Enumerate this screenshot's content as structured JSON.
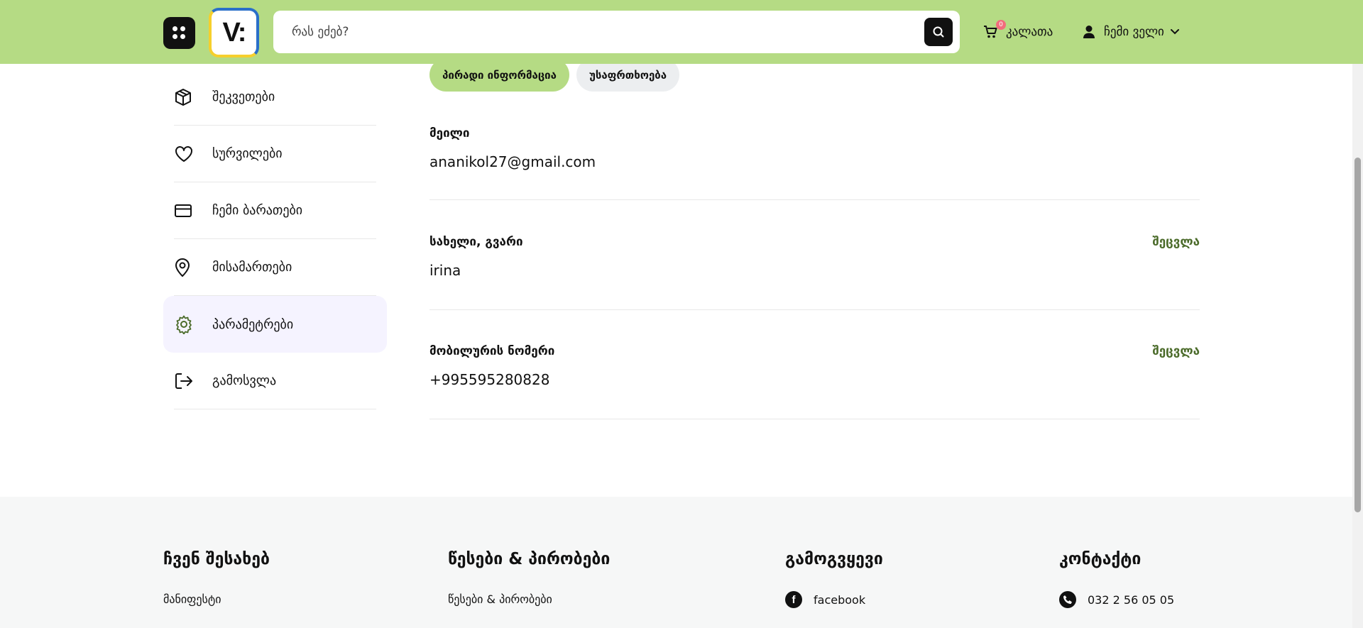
{
  "header": {
    "search_placeholder": "რას ეძებ?",
    "cart_label": "კალათა",
    "cart_count": "0",
    "account_label": "ჩემი ველი",
    "logo_text": "V:"
  },
  "sidebar": {
    "items": [
      {
        "label": "შეკვეთები",
        "icon": "box-icon"
      },
      {
        "label": "სურვილები",
        "icon": "heart-icon"
      },
      {
        "label": "ჩემი ბარათები",
        "icon": "card-icon"
      },
      {
        "label": "მისამართები",
        "icon": "location-icon"
      },
      {
        "label": "პარამეტრები",
        "icon": "gear-icon",
        "active": true
      },
      {
        "label": "გამოსვლა",
        "icon": "logout-icon"
      }
    ]
  },
  "tabs": {
    "personal": "პირადი ინფორმაცია",
    "security": "უსაფრთხოება"
  },
  "fields": {
    "email": {
      "label": "მეილი",
      "value": "ananikol27@gmail.com"
    },
    "name": {
      "label": "სახელი, გვარი",
      "value": "irina",
      "edit": "შეცვლა"
    },
    "phone": {
      "label": "მობილურის ნომერი",
      "value": "+995595280828",
      "edit": "შეცვლა"
    }
  },
  "footer": {
    "about_title": "ჩვენ შესახებ",
    "about_link": "მანიფესტი",
    "terms_title": "წესები & პირობები",
    "terms_link": "წესები & პირობები",
    "follow_title": "გამოგვყევი",
    "follow_link": "facebook",
    "contact_title": "კონტაქტი",
    "contact_link": "032 2 56 05 05"
  },
  "colors": {
    "brand_green": "#b5db84",
    "edit_green": "#4b6b2a",
    "active_bg": "#f5f3ff"
  }
}
